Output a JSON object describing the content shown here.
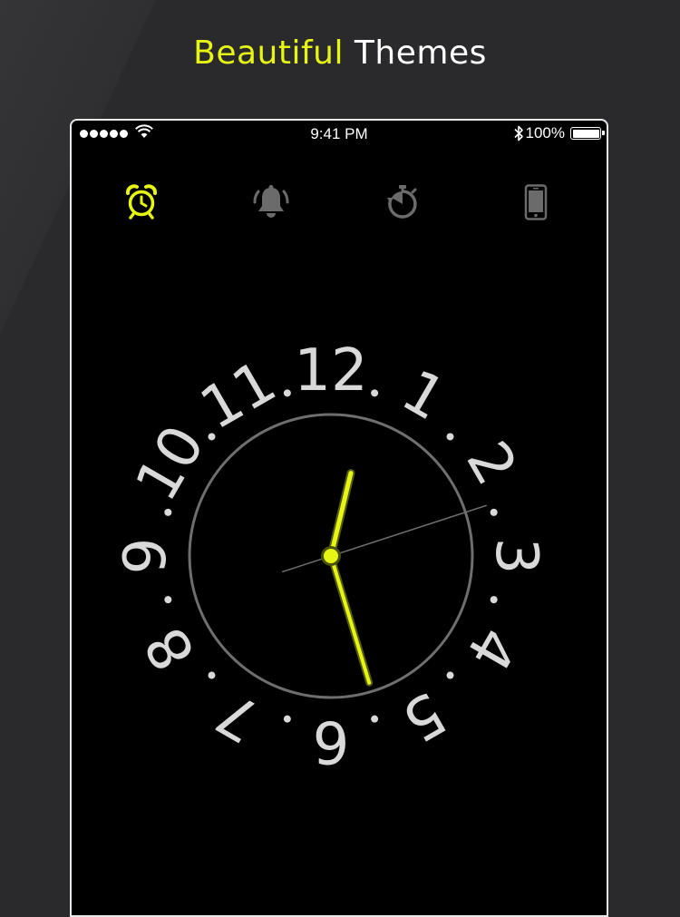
{
  "headline": {
    "accent": "Beautiful",
    "rest": "Themes"
  },
  "status_bar": {
    "time": "9:41 PM",
    "battery": "100%",
    "battery_level": 1.0,
    "signal_bars": 5
  },
  "tabs": [
    {
      "icon": "alarm-clock-icon",
      "active": true
    },
    {
      "icon": "bell-icon",
      "active": false
    },
    {
      "icon": "stopwatch-icon",
      "active": false
    },
    {
      "icon": "phone-icon",
      "active": false
    }
  ],
  "clock": {
    "numerals": [
      "12",
      "1",
      "2",
      "3",
      "4",
      "5",
      "6",
      "7",
      "8",
      "9",
      "10",
      "11"
    ],
    "time_shown": {
      "hour": 12,
      "minute": 27,
      "second": 12
    }
  },
  "colors": {
    "accent": "#e6f514",
    "background": "#2a2a2c",
    "screen": "#000000",
    "numeral": "#d9d9d9",
    "inactive_icon": "#6b6b6b"
  }
}
